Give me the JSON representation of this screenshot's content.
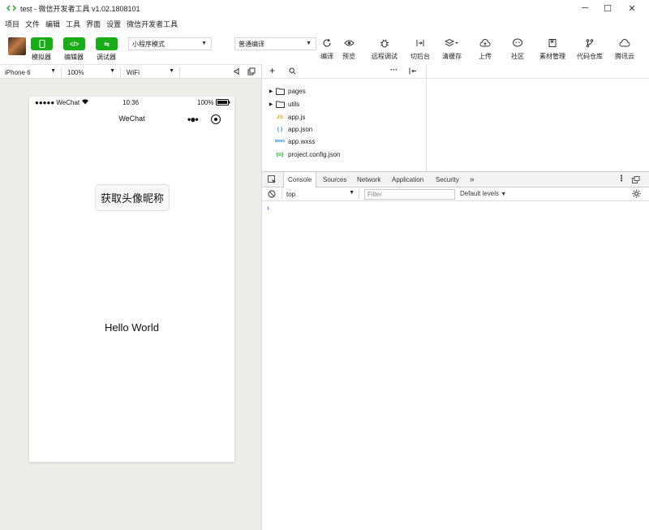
{
  "window": {
    "title": "test - 微信开发者工具 v1.02.1808101",
    "controls": [
      "─",
      "☐",
      "✕"
    ]
  },
  "menu": [
    "项目",
    "文件",
    "编辑",
    "工具",
    "界面",
    "设置",
    "微信开发者工具"
  ],
  "toolbar": {
    "simulator_label": "模拟器",
    "editor_label": "编辑器",
    "debugger_label": "调试器",
    "mode_select": "小程序模式",
    "compile_select": "普通编译",
    "compile_label": "编译",
    "preview_label": "预览",
    "remote_debug_label": "远程调试",
    "background_label": "切后台",
    "clear_cache_label": "清缓存",
    "upload_label": "上传",
    "community_label": "社区",
    "assets_label": "素材管理",
    "repo_label": "代码仓库",
    "tencent_cloud_label": "腾讯云"
  },
  "device_bar": {
    "device": "iPhone 6",
    "zoom": "100%",
    "network": "WiFi"
  },
  "phone": {
    "carrier": "●●●●● WeChat",
    "time": "10:36",
    "battery": "100%",
    "nav_title": "WeChat",
    "button_label": "获取头像昵称",
    "hello_text": "Hello World"
  },
  "file_tree": [
    {
      "name": "pages",
      "type": "folder"
    },
    {
      "name": "utils",
      "type": "folder"
    },
    {
      "name": "app.js",
      "type": "js",
      "icon": "JS"
    },
    {
      "name": "app.json",
      "type": "json",
      "icon": "{ }"
    },
    {
      "name": "app.wxss",
      "type": "wxss",
      "icon": "wxss"
    },
    {
      "name": "project.config.json",
      "type": "config",
      "icon": "{o}"
    }
  ],
  "devtools": {
    "tabs": [
      "Console",
      "Sources",
      "Network",
      "Application",
      "Security"
    ],
    "more": "»",
    "context": "top",
    "filter_placeholder": "Filter",
    "levels": "Default levels",
    "prompt": "›"
  },
  "colors": {
    "accent_green": "#1aad19",
    "simulator_bg": "#eeedea",
    "js_icon": "#f0a020",
    "json_icon": "#2a86d1",
    "config_icon": "#1aad19"
  }
}
